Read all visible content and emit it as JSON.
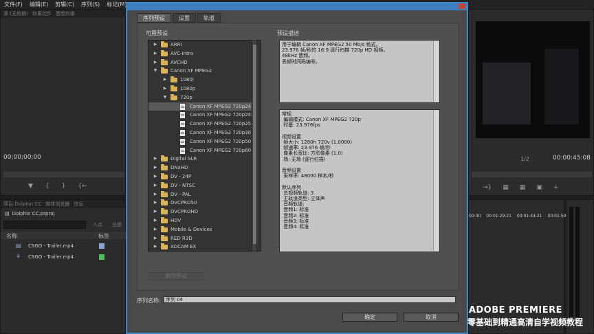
{
  "menubar": [
    "文件(F)",
    "编辑(E)",
    "剪辑(C)",
    "序列(S)",
    "标记(M)"
  ],
  "background": {
    "left_panel_tabs": [
      "源:(无剪辑)",
      "效果控件",
      "音频剪辑"
    ],
    "left_timecode": "00;00;00;00",
    "right_timecode": "00:00:45:08",
    "right_fit": "1/2",
    "project_tabs": [
      "项目:Dolphin CC",
      "媒体浏览器",
      "信息"
    ],
    "project_name": "Dolphin CC.prproj",
    "project_search_tail": "入点",
    "project_search_tail2": "全部",
    "col_name": "名称",
    "col_label": "标签",
    "items": [
      {
        "name": "CSGO - Trailer.mp4",
        "color": "#8aa4d6"
      },
      {
        "name": "CSGO - Trailer.mp4",
        "color": "#4cbf5a"
      }
    ],
    "timeline_times": [
      "00:00",
      "00:01:29:21",
      "00:01:44:21",
      "00:01:59:21"
    ]
  },
  "dialog": {
    "tabs": [
      "序列预设",
      "设置",
      "轨道"
    ],
    "available_presets_label": "可用预设",
    "preset_desc_label": "预设描述",
    "tree": [
      {
        "label": "ARRI",
        "depth": 0,
        "type": "folder",
        "open": false
      },
      {
        "label": "AVC-Intra",
        "depth": 0,
        "type": "folder",
        "open": false
      },
      {
        "label": "AVCHD",
        "depth": 0,
        "type": "folder",
        "open": false
      },
      {
        "label": "Canon XF MPEG2",
        "depth": 0,
        "type": "folder",
        "open": true
      },
      {
        "label": "1080i",
        "depth": 1,
        "type": "folder",
        "open": false
      },
      {
        "label": "1080p",
        "depth": 1,
        "type": "folder",
        "open": false
      },
      {
        "label": "720p",
        "depth": 1,
        "type": "folder",
        "open": true
      },
      {
        "label": "Canon XF MPEG2 720p24",
        "depth": 2,
        "type": "file",
        "selected": true
      },
      {
        "label": "Canon XF MPEG2 720p24N",
        "depth": 2,
        "type": "file"
      },
      {
        "label": "Canon XF MPEG2 720p25",
        "depth": 2,
        "type": "file"
      },
      {
        "label": "Canon XF MPEG2 720p30",
        "depth": 2,
        "type": "file"
      },
      {
        "label": "Canon XF MPEG2 720p50",
        "depth": 2,
        "type": "file"
      },
      {
        "label": "Canon XF MPEG2 720p60",
        "depth": 2,
        "type": "file"
      },
      {
        "label": "Digital SLR",
        "depth": 0,
        "type": "folder",
        "open": false
      },
      {
        "label": "DNxHD",
        "depth": 0,
        "type": "folder",
        "open": false
      },
      {
        "label": "DV - 24P",
        "depth": 0,
        "type": "folder",
        "open": false
      },
      {
        "label": "DV - NTSC",
        "depth": 0,
        "type": "folder",
        "open": false
      },
      {
        "label": "DV - PAL",
        "depth": 0,
        "type": "folder",
        "open": false
      },
      {
        "label": "DVCPRO50",
        "depth": 0,
        "type": "folder",
        "open": false
      },
      {
        "label": "DVCPROHD",
        "depth": 0,
        "type": "folder",
        "open": false
      },
      {
        "label": "HDV",
        "depth": 0,
        "type": "folder",
        "open": false
      },
      {
        "label": "Mobile & Devices",
        "depth": 0,
        "type": "folder",
        "open": false
      },
      {
        "label": "RED R3D",
        "depth": 0,
        "type": "folder",
        "open": false
      },
      {
        "label": "XDCAM EX",
        "depth": 0,
        "type": "folder",
        "open": false
      }
    ],
    "description": [
      "用于编辑 Canon XF MPEG2 50 Mb/s 格式。",
      "23.976 帧/秒的 16:9 逐行扫描 720p HD 视频。",
      "48kHz 音频。",
      "丢帧时间码编号。"
    ],
    "details": [
      "常规",
      " 编辑模式: Canon XF MPEG2 720p",
      " 时基: 23.976fps",
      "",
      "视频设置",
      " 帧大小: 1280h 720v (1.0000)",
      " 帧速率: 23.976 帧/秒",
      " 像素长宽比: 方形像素 (1.0)",
      " 场: 无场 (逐行扫描)",
      "",
      "音频设置",
      " 采样率: 48000 样本/秒",
      "",
      "默认序列",
      " 总视频轨道: 3",
      " 主轨道类型: 立体声",
      " 音频轨道:",
      " 音频1: 标准",
      " 音频2: 标准",
      " 音频3: 标准",
      " 音频4: 标准"
    ],
    "delete_preset_label": "删除预设",
    "sequence_name_label": "序列名称:",
    "sequence_name_value": "序列 04",
    "ok_label": "确定",
    "cancel_label": "取消"
  },
  "watermark": {
    "line1": "ADOBE PREMIERE",
    "line2": "零基础到精通高清自学视频教程"
  }
}
